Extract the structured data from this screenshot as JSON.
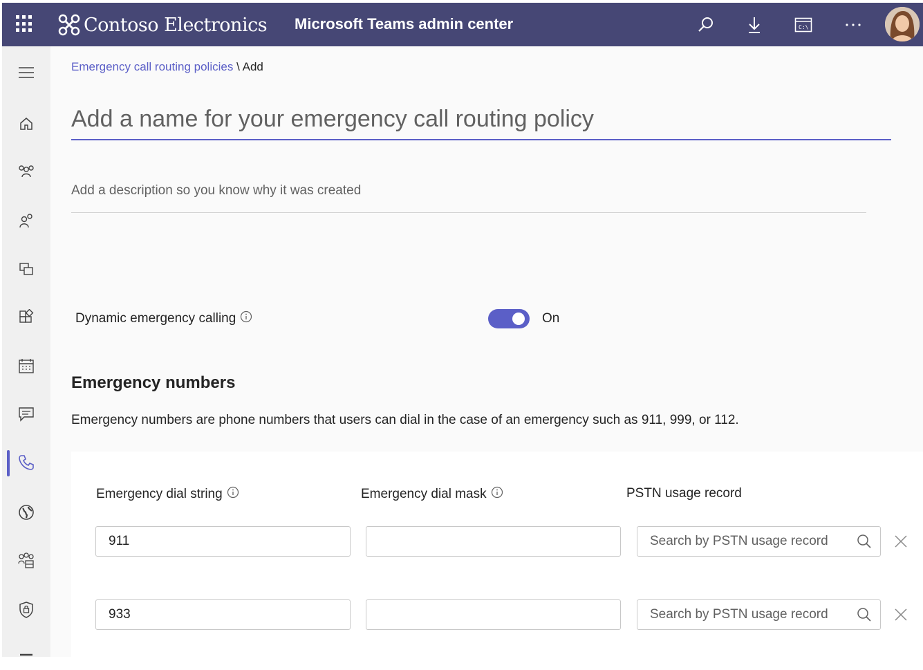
{
  "header": {
    "brand": "Contoso Electronics",
    "title": "Microsoft Teams admin center",
    "bg_color": "#464775",
    "icons": [
      "app-launcher-icon",
      "search-icon",
      "download-icon",
      "terminal-icon",
      "more-icon",
      "avatar"
    ]
  },
  "sidebar": {
    "items": [
      {
        "icon": "menu-icon"
      },
      {
        "icon": "home-icon"
      },
      {
        "icon": "teams-icon"
      },
      {
        "icon": "users-icon"
      },
      {
        "icon": "devices-icon"
      },
      {
        "icon": "apps-icon"
      },
      {
        "icon": "meetings-icon"
      },
      {
        "icon": "messaging-icon"
      },
      {
        "icon": "voice-icon",
        "active": true
      },
      {
        "icon": "locations-icon"
      },
      {
        "icon": "enhanced-encryption-icon"
      },
      {
        "icon": "policy-packages-icon"
      }
    ],
    "accent": "#5b5fc7"
  },
  "breadcrumb": {
    "link": "Emergency call routing policies",
    "separator": "\\",
    "current": "Add"
  },
  "form": {
    "name_placeholder": "Add a name for your emergency call routing policy",
    "description_placeholder": "Add a description so you know why it was created",
    "dynamic_label": "Dynamic emergency calling",
    "toggle_state": "On"
  },
  "emergency": {
    "title": "Emergency numbers",
    "description": "Emergency numbers are phone numbers that users can dial in the case of an emergency such as 911, 999, or 112.",
    "columns": {
      "dial_string": "Emergency dial string",
      "dial_mask": "Emergency dial mask",
      "pstn": "PSTN usage record"
    },
    "rows": [
      {
        "dial_string": "911",
        "dial_mask": "",
        "pstn_placeholder": "Search by PSTN usage record"
      },
      {
        "dial_string": "933",
        "dial_mask": "",
        "pstn_placeholder": "Search by PSTN usage record"
      }
    ]
  }
}
